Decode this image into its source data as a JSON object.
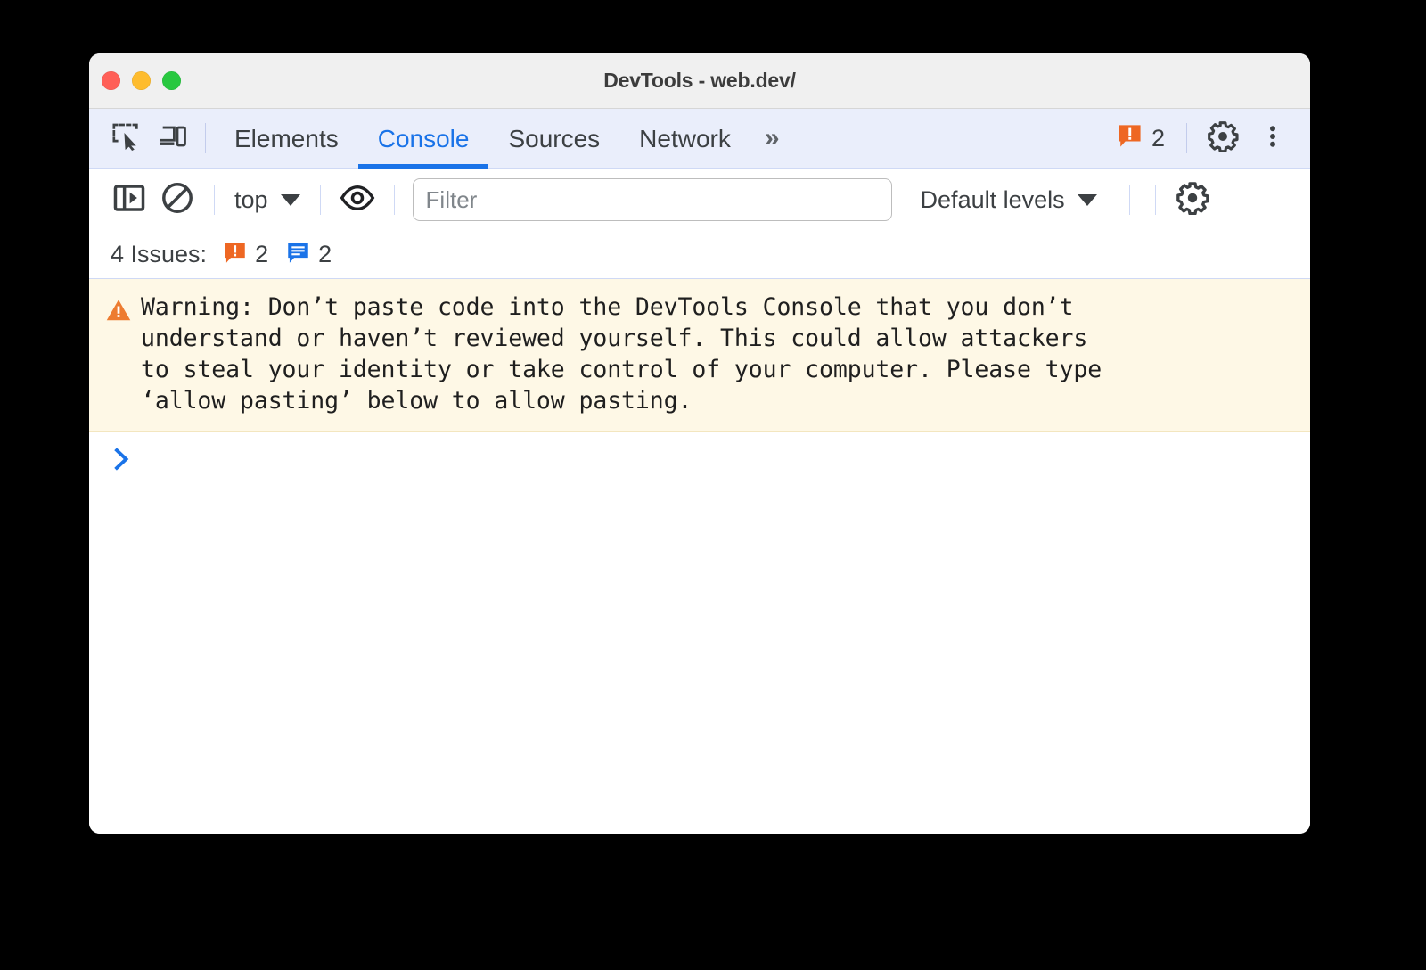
{
  "window": {
    "title": "DevTools - web.dev/",
    "traffic_lights": [
      {
        "name": "close",
        "color": "#ff5f57"
      },
      {
        "name": "minimize",
        "color": "#febc2e"
      },
      {
        "name": "maximize",
        "color": "#28c840"
      }
    ]
  },
  "tabbar": {
    "icons": [
      {
        "name": "inspect-element-icon",
        "label": "Inspect element"
      },
      {
        "name": "device-toolbar-icon",
        "label": "Toggle device toolbar"
      }
    ],
    "tabs": [
      {
        "label": "Elements",
        "active": false
      },
      {
        "label": "Console",
        "active": true
      },
      {
        "label": "Sources",
        "active": false
      },
      {
        "label": "Network",
        "active": false
      }
    ],
    "more_tabs": "»",
    "warning_badge": {
      "icon": "warning-bubble-icon",
      "count": "2",
      "color": "#ee6723"
    },
    "settings_icon": "gear-icon",
    "menu_icon": "kebab-menu-icon",
    "accent_color": "#1a73e8",
    "background": "#eaeefb"
  },
  "console_toolbar": {
    "sidebar_toggle_icon": "console-sidebar-icon",
    "clear_console_icon": "clear-console-icon",
    "context_selector": {
      "label": "top",
      "caret": "▼"
    },
    "live_expression_icon": "eye-icon",
    "filter": {
      "value": "",
      "placeholder": "Filter"
    },
    "levels_selector": {
      "label": "Default levels",
      "caret": "▼"
    },
    "settings_icon": "gear-icon"
  },
  "issues_bar": {
    "label": "4 Issues:",
    "groups": [
      {
        "icon": "warning-bubble-icon",
        "count": "2",
        "color": "#ee6723"
      },
      {
        "icon": "info-bubble-icon",
        "count": "2",
        "color": "#1a73e8"
      }
    ]
  },
  "console": {
    "messages": [
      {
        "type": "warning",
        "icon": "warning-triangle-icon",
        "background": "#fef8e6",
        "text": "Warning: Don’t paste code into the DevTools Console that you don’t\nunderstand or haven’t reviewed yourself. This could allow attackers\nto steal your identity or take control of your computer. Please type\n‘allow pasting’ below to allow pasting."
      }
    ],
    "prompt": {
      "icon": "prompt-chevron-icon",
      "value": ""
    }
  }
}
